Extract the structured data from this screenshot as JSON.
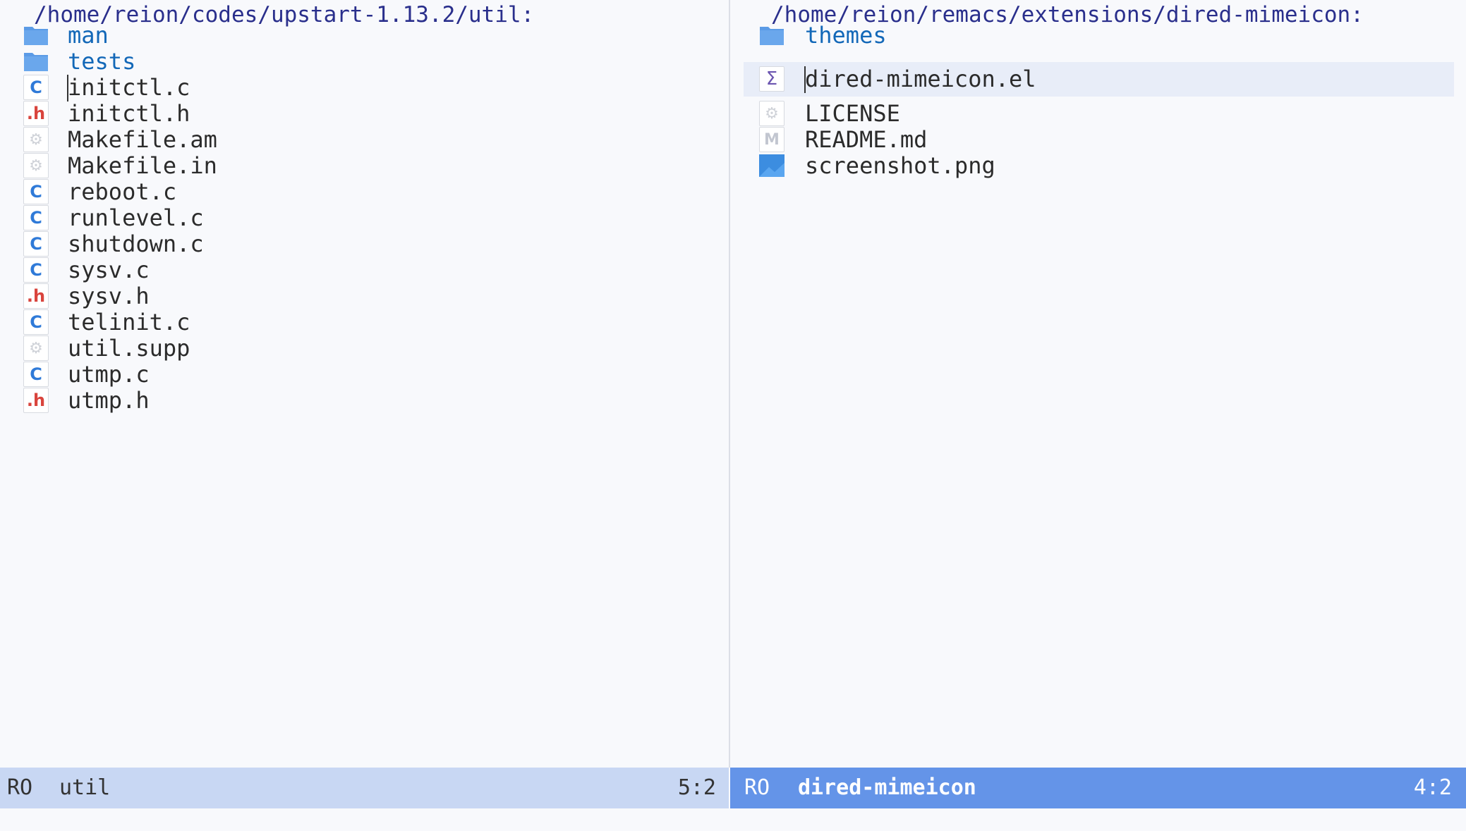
{
  "colors": {
    "background": "#f8f9fc",
    "directory_text": "#1368b8",
    "file_text": "#2b2b2b",
    "path_text": "#2a2f8c",
    "modeline_inactive": "#c8d7f3",
    "modeline_active": "#6494e8",
    "c_icon": "#2f7ad8",
    "h_icon": "#d9443d",
    "folder_icon": "#5b9be6"
  },
  "left_pane": {
    "path": "/home/reion/codes/upstart-1.13.2/util:",
    "entries": [
      {
        "name": "man",
        "type": "directory",
        "icon": "folder-icon"
      },
      {
        "name": "tests",
        "type": "directory",
        "icon": "folder-icon"
      },
      {
        "name": "initctl.c",
        "type": "file",
        "icon": "c-file-icon"
      },
      {
        "name": "initctl.h",
        "type": "file",
        "icon": "h-file-icon"
      },
      {
        "name": "Makefile.am",
        "type": "file",
        "icon": "config-file-icon"
      },
      {
        "name": "Makefile.in",
        "type": "file",
        "icon": "config-file-icon"
      },
      {
        "name": "reboot.c",
        "type": "file",
        "icon": "c-file-icon"
      },
      {
        "name": "runlevel.c",
        "type": "file",
        "icon": "c-file-icon"
      },
      {
        "name": "shutdown.c",
        "type": "file",
        "icon": "c-file-icon"
      },
      {
        "name": "sysv.c",
        "type": "file",
        "icon": "c-file-icon"
      },
      {
        "name": "sysv.h",
        "type": "file",
        "icon": "h-file-icon"
      },
      {
        "name": "telinit.c",
        "type": "file",
        "icon": "c-file-icon"
      },
      {
        "name": "util.supp",
        "type": "file",
        "icon": "config-file-icon"
      },
      {
        "name": "utmp.c",
        "type": "file",
        "icon": "c-file-icon"
      },
      {
        "name": "utmp.h",
        "type": "file",
        "icon": "h-file-icon"
      }
    ],
    "cursor_on": "initctl.c",
    "modeline": {
      "state": "RO",
      "buffer": "util",
      "position": "5:2"
    }
  },
  "right_pane": {
    "path": "/home/reion/remacs/extensions/dired-mimeicon:",
    "entries": [
      {
        "name": "themes",
        "type": "directory",
        "icon": "folder-icon"
      },
      {
        "name": "dired-mimeicon.el",
        "type": "file",
        "icon": "elisp-file-icon"
      },
      {
        "name": "LICENSE",
        "type": "file",
        "icon": "config-file-icon"
      },
      {
        "name": "README.md",
        "type": "file",
        "icon": "markdown-file-icon"
      },
      {
        "name": "screenshot.png",
        "type": "file",
        "icon": "image-file-icon"
      }
    ],
    "cursor_on": "dired-mimeicon.el",
    "highlighted": "dired-mimeicon.el",
    "modeline": {
      "state": "RO",
      "buffer": "dired-mimeicon",
      "position": "4:2"
    }
  }
}
